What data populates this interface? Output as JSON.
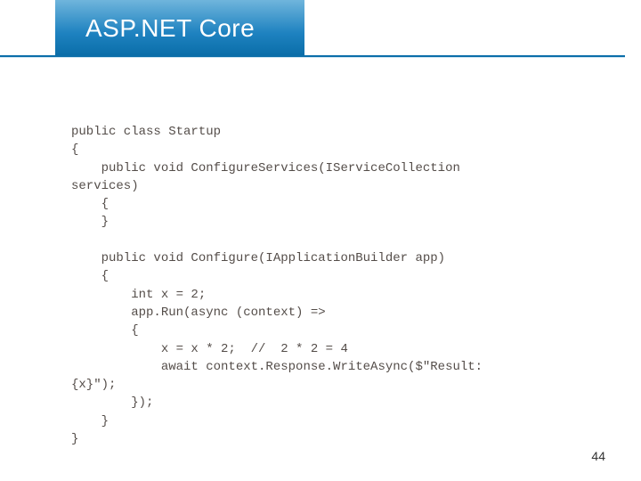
{
  "header": {
    "title": "ASP.NET Core"
  },
  "code": {
    "lines": [
      "public class Startup",
      "{",
      "    public void ConfigureServices(IServiceCollection",
      "services)",
      "    {",
      "    }",
      "",
      "    public void Configure(IApplicationBuilder app)",
      "    {",
      "        int x = 2;",
      "        app.Run(async (context) =>",
      "        {",
      "            x = x * 2;  //  2 * 2 = 4",
      "            await context.Response.WriteAsync($\"Result:",
      "{x}\");",
      "        });",
      "    }",
      "}"
    ]
  },
  "pageNumber": "44"
}
